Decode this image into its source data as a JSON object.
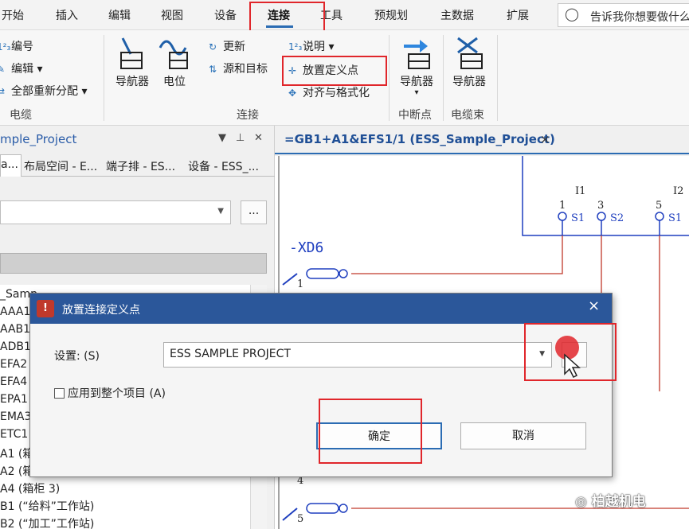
{
  "ribbon_tabs": [
    "开始",
    "插入",
    "编辑",
    "视图",
    "设备",
    "连接",
    "工具",
    "预规划",
    "主数据",
    "扩展"
  ],
  "active_tab": "连接",
  "search_placeholder": "告诉我你想要做什么",
  "ribbon": {
    "cable_group": {
      "items": [
        "编号",
        "编辑",
        "全部重新分配"
      ],
      "label": "电缆"
    },
    "connection_group": {
      "navigator": "导航器",
      "potential": "电位",
      "update": "更新",
      "source_target": "源和目标",
      "description": "说明",
      "place_definition_point": "放置定义点",
      "align_format": "对齐与格式化",
      "label": "连接"
    },
    "break_group": {
      "navigator": "导航器",
      "label": "中断点"
    },
    "bundle_group": {
      "navigator": "导航器",
      "label": "电缆束"
    }
  },
  "left_panel": {
    "title": "mple_Project",
    "tabs": [
      "a...",
      "布局空间 - E...",
      "端子排 - ES...",
      "设备 - ESS_..."
    ],
    "tree_items": [
      "_Samp",
      "AAA1",
      "AAB1",
      "ADB1",
      "EFA2",
      "EFA4",
      "EPA1",
      "EMA3",
      "ETC1",
      "A1 (箱",
      "A2 (箱",
      "A4 (箱柜 3)",
      "B1 (“给料”工作站)",
      "B2 (“加工”工作站)"
    ],
    "more_button": "..."
  },
  "document": {
    "tab_title": "=GB1+A1&EFS1/1 (ESS_Sample_Project)",
    "close": "×",
    "schematic": {
      "device_tag": "-XD6",
      "terminal_numbers": [
        "1",
        "4",
        "5"
      ],
      "group_labels": [
        "I1",
        "I2"
      ],
      "pin_numbers": [
        "1",
        "3",
        "5"
      ],
      "pin_labels": [
        "S1",
        "S2",
        "S1"
      ]
    }
  },
  "dialog": {
    "title": "放置连接定义点",
    "close": "×",
    "setting_label": "设置: (S)",
    "setting_value": "ESS SAMPLE PROJECT",
    "apply_checkbox": "应用到整个项目 (A)",
    "apply_checked": false,
    "ok": "确定",
    "cancel": "取消"
  },
  "watermark": "柏越机电",
  "colors": {
    "accent": "#2b6cb3",
    "dialog_title": "#2b579a",
    "highlight": "#e0262b",
    "wire_red": "#c0392b",
    "wire_blue": "#1f3fbf"
  }
}
